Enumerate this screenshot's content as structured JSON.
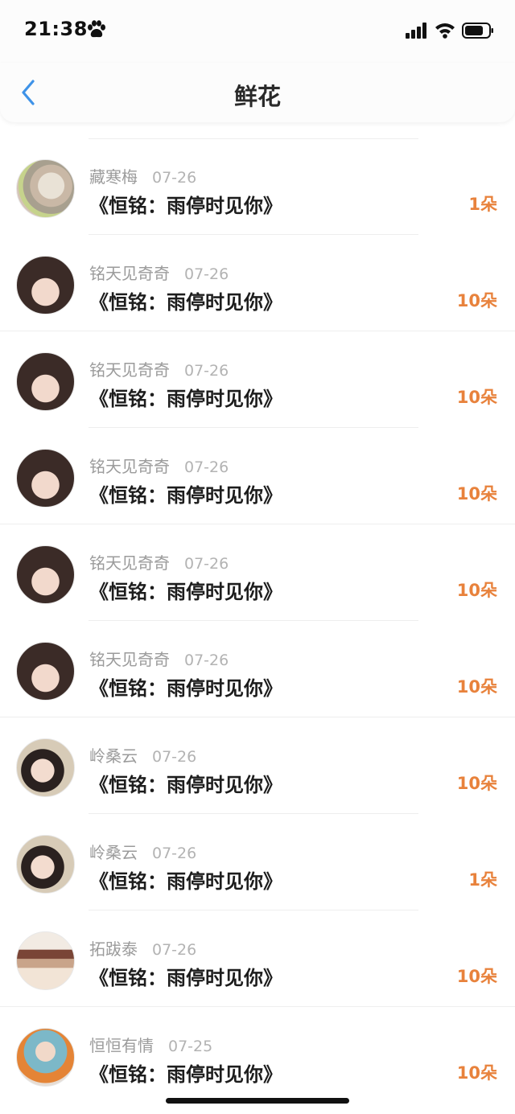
{
  "status_bar": {
    "time": "21:38",
    "icons": [
      "paw-icon",
      "signal-icon",
      "wifi-icon",
      "battery-icon"
    ]
  },
  "nav": {
    "title": "鲜花",
    "back_icon": "chevron-left-icon"
  },
  "colors": {
    "accent": "#e8823c",
    "back": "#3f93e8",
    "name": "#9b9b9b",
    "title": "#1d1d1d"
  },
  "items": [
    {
      "user": "藏寒梅",
      "date": "07-26",
      "book": "《恒铭：雨停时见你》",
      "count": "1朵",
      "avatar": "av-plum"
    },
    {
      "user": "铭天见奇奇",
      "date": "07-26",
      "book": "《恒铭：雨停时见你》",
      "count": "10朵",
      "avatar": "av-girl"
    },
    {
      "user": "铭天见奇奇",
      "date": "07-26",
      "book": "《恒铭：雨停时见你》",
      "count": "10朵",
      "avatar": "av-girl"
    },
    {
      "user": "铭天见奇奇",
      "date": "07-26",
      "book": "《恒铭：雨停时见你》",
      "count": "10朵",
      "avatar": "av-girl"
    },
    {
      "user": "铭天见奇奇",
      "date": "07-26",
      "book": "《恒铭：雨停时见你》",
      "count": "10朵",
      "avatar": "av-girl"
    },
    {
      "user": "铭天见奇奇",
      "date": "07-26",
      "book": "《恒铭：雨停时见你》",
      "count": "10朵",
      "avatar": "av-girl"
    },
    {
      "user": "岭桑云",
      "date": "07-26",
      "book": "《恒铭：雨停时见你》",
      "count": "10朵",
      "avatar": "av-sang"
    },
    {
      "user": "岭桑云",
      "date": "07-26",
      "book": "《恒铭：雨停时见你》",
      "count": "1朵",
      "avatar": "av-sang"
    },
    {
      "user": "拓跋泰",
      "date": "07-26",
      "book": "《恒铭：雨停时见你》",
      "count": "10朵",
      "avatar": "av-tuo"
    },
    {
      "user": "恒恒有情",
      "date": "07-25",
      "book": "《恒铭：雨停时见你》",
      "count": "10朵",
      "avatar": "av-heng"
    }
  ]
}
